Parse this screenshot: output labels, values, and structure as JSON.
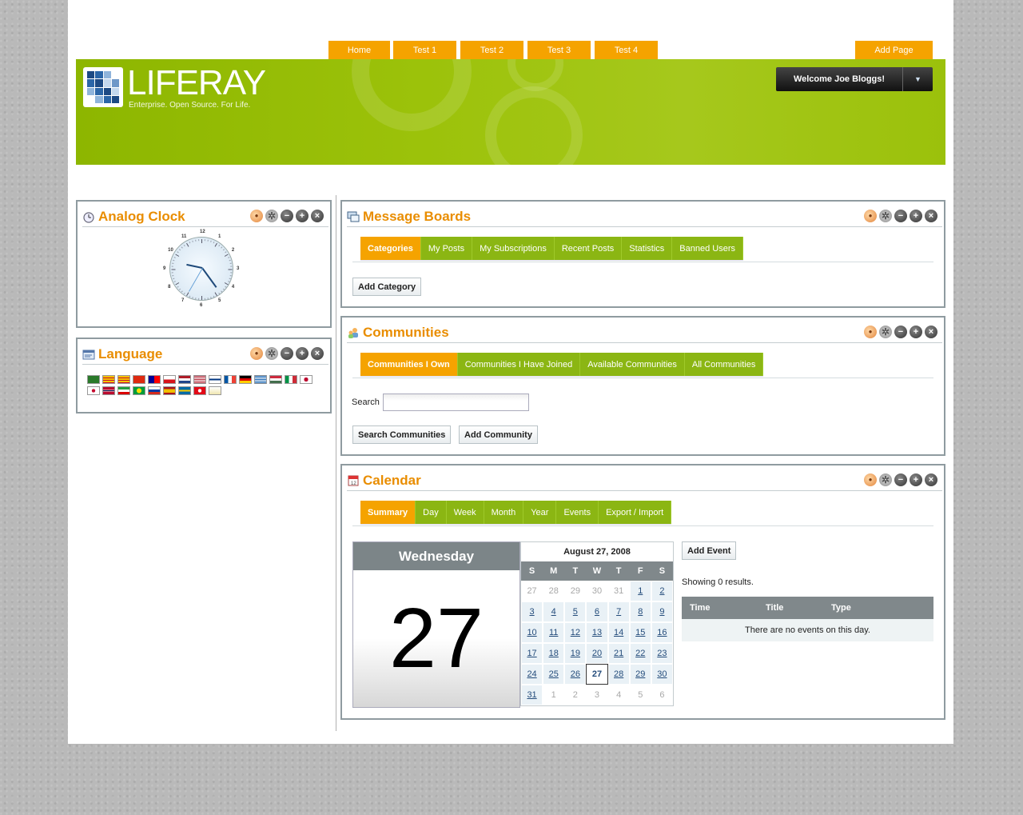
{
  "nav": {
    "tabs": [
      "Home",
      "Test 1",
      "Test 2",
      "Test 3",
      "Test 4"
    ],
    "add_page": "Add Page"
  },
  "header": {
    "logo_text": "LIFERAY",
    "tagline": "Enterprise. Open Source. For Life.",
    "welcome": "Welcome Joe Bloggs!"
  },
  "clock": {
    "title": "Analog Clock",
    "numbers": [
      "12",
      "1",
      "2",
      "3",
      "4",
      "5",
      "6",
      "7",
      "8",
      "9",
      "10",
      "11"
    ],
    "time": {
      "hour": 9,
      "minute": 24,
      "second": 35
    }
  },
  "language": {
    "title": "Language",
    "flags": [
      "ar",
      "ca",
      "ca-es",
      "zh-cn",
      "zh-tw",
      "cs",
      "nl",
      "en",
      "fi",
      "fr",
      "de",
      "el",
      "hu",
      "it",
      "ja",
      "ko",
      "nb",
      "fa",
      "pt",
      "ru",
      "es",
      "sv",
      "tr",
      "vi"
    ]
  },
  "message_boards": {
    "title": "Message Boards",
    "tabs": [
      "Categories",
      "My Posts",
      "My Subscriptions",
      "Recent Posts",
      "Statistics",
      "Banned Users"
    ],
    "add_category": "Add Category"
  },
  "communities": {
    "title": "Communities",
    "tabs": [
      "Communities I Own",
      "Communities I Have Joined",
      "Available Communities",
      "All Communities"
    ],
    "search_label": "Search",
    "search_value": "",
    "search_button": "Search Communities",
    "add_button": "Add Community"
  },
  "calendar": {
    "title": "Calendar",
    "tabs": [
      "Summary",
      "Day",
      "Week",
      "Month",
      "Year",
      "Events",
      "Export / Import"
    ],
    "day_name": "Wednesday",
    "day_num": "27",
    "month_title": "August 27, 2008",
    "weekdays": [
      "S",
      "M",
      "T",
      "W",
      "T",
      "F",
      "S"
    ],
    "cells": [
      [
        "27",
        false
      ],
      [
        "28",
        false
      ],
      [
        "29",
        false
      ],
      [
        "30",
        false
      ],
      [
        "31",
        false
      ],
      [
        "1",
        true
      ],
      [
        "2",
        true
      ],
      [
        "3",
        true
      ],
      [
        "4",
        true
      ],
      [
        "5",
        true
      ],
      [
        "6",
        true
      ],
      [
        "7",
        true
      ],
      [
        "8",
        true
      ],
      [
        "9",
        true
      ],
      [
        "10",
        true
      ],
      [
        "11",
        true
      ],
      [
        "12",
        true
      ],
      [
        "13",
        true
      ],
      [
        "14",
        true
      ],
      [
        "15",
        true
      ],
      [
        "16",
        true
      ],
      [
        "17",
        true
      ],
      [
        "18",
        true
      ],
      [
        "19",
        true
      ],
      [
        "20",
        true
      ],
      [
        "21",
        true
      ],
      [
        "22",
        true
      ],
      [
        "23",
        true
      ],
      [
        "24",
        true
      ],
      [
        "25",
        true
      ],
      [
        "26",
        true
      ],
      [
        "27",
        true
      ],
      [
        "28",
        true
      ],
      [
        "29",
        true
      ],
      [
        "30",
        true
      ],
      [
        "31",
        true
      ],
      [
        "1",
        false
      ],
      [
        "2",
        false
      ],
      [
        "3",
        false
      ],
      [
        "4",
        false
      ],
      [
        "5",
        false
      ],
      [
        "6",
        false
      ]
    ],
    "today": "27",
    "add_event": "Add Event",
    "showing": "Showing 0 results.",
    "columns": [
      "Time",
      "Title",
      "Type"
    ],
    "empty": "There are no events on this day."
  },
  "colors": {
    "accent_orange": "#f5a300",
    "accent_green": "#8bb613",
    "title_orange": "#e98d00"
  }
}
